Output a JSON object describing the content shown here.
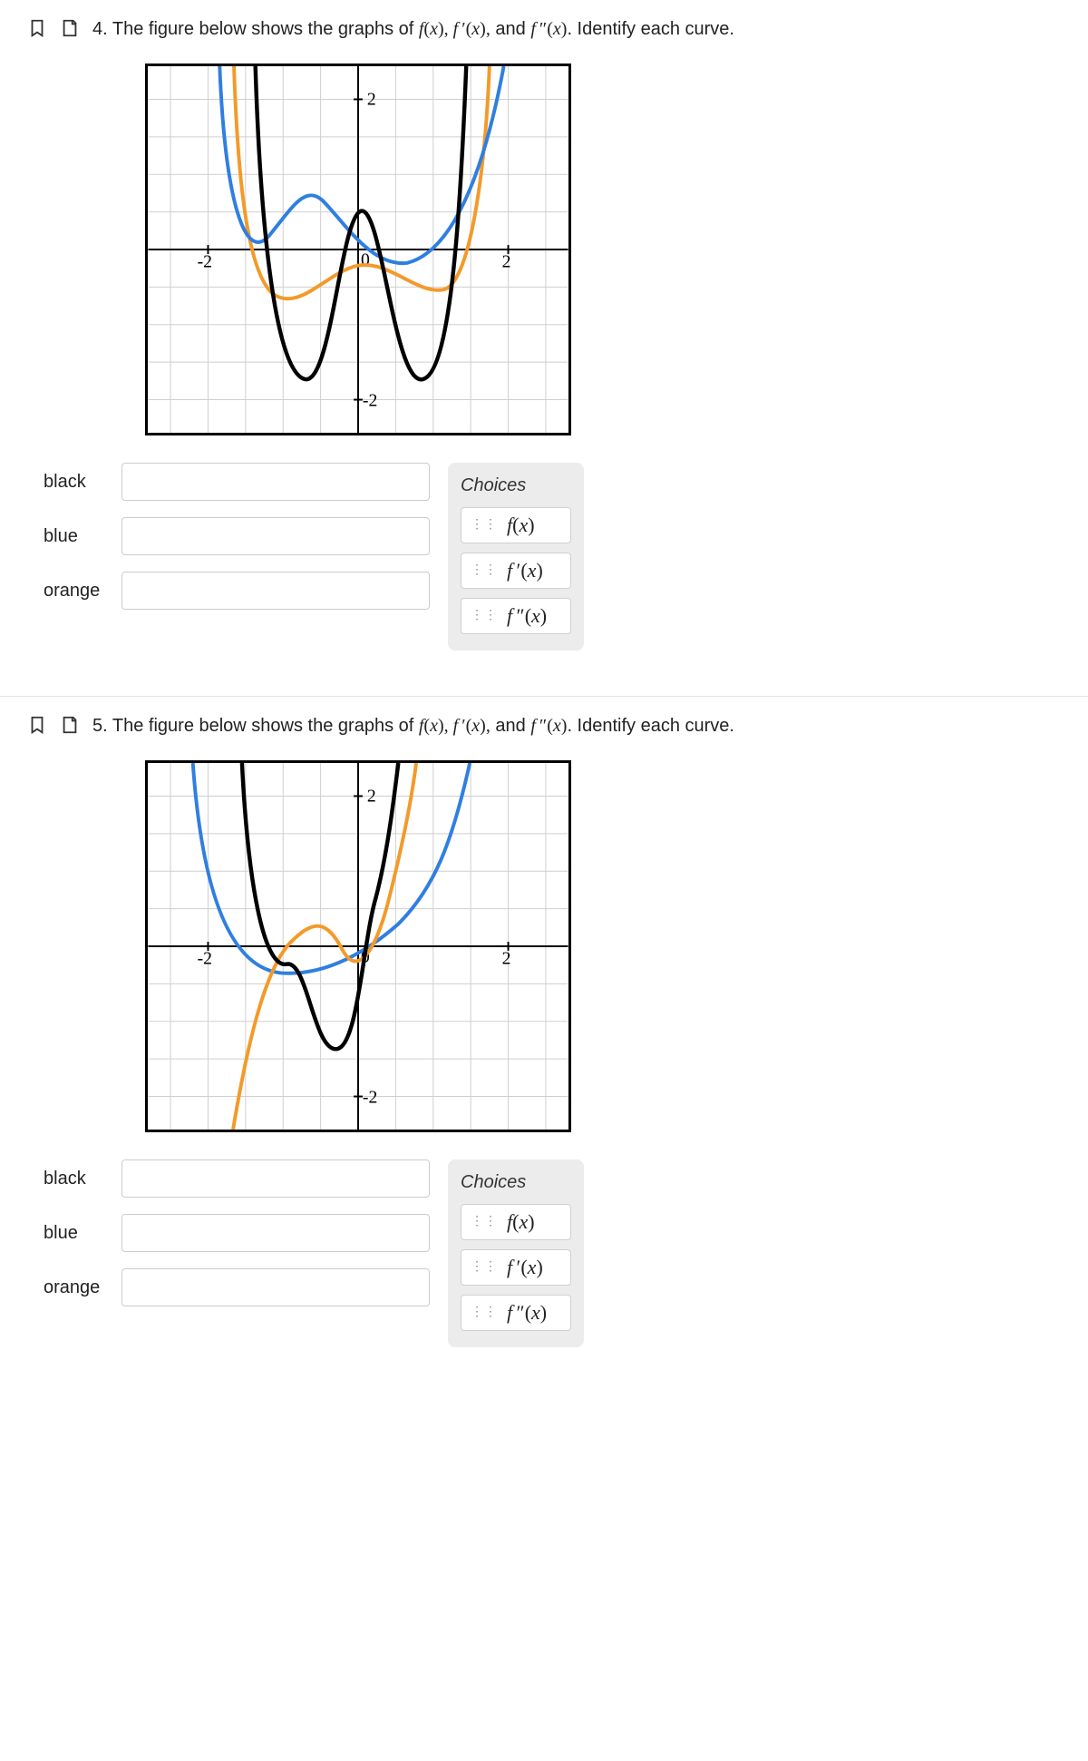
{
  "questions": [
    {
      "number": "4.",
      "prompt_prefix": "The figure below shows the graphs of ",
      "prompt_math": "f(x), f′(x), and f″(x).",
      "prompt_suffix": " Identify each curve.",
      "slots": [
        "black",
        "blue",
        "orange"
      ],
      "choices_title": "Choices",
      "choices": [
        "f(x)",
        "f′(x)",
        "f″(x)"
      ],
      "chart_data": {
        "type": "line",
        "xlim": [
          -2.8,
          2.8
        ],
        "ylim": [
          -2.6,
          2.6
        ],
        "xticks": [
          -2,
          0,
          2
        ],
        "yticks": [
          -2,
          2
        ],
        "series": [
          {
            "name": "blue",
            "color": "#2f7fe0"
          },
          {
            "name": "orange",
            "color": "#f39a2a"
          },
          {
            "name": "black",
            "color": "#000000"
          }
        ]
      }
    },
    {
      "number": "5.",
      "prompt_prefix": "The figure below shows the graphs of ",
      "prompt_math": "f(x), f′(x), and f″(x).",
      "prompt_suffix": " Identify each curve.",
      "slots": [
        "black",
        "blue",
        "orange"
      ],
      "choices_title": "Choices",
      "choices": [
        "f(x)",
        "f′(x)",
        "f″(x)"
      ],
      "chart_data": {
        "type": "line",
        "xlim": [
          -2.8,
          2.8
        ],
        "ylim": [
          -2.6,
          2.6
        ],
        "xticks": [
          -2,
          0,
          2
        ],
        "yticks": [
          -2,
          2
        ],
        "series": [
          {
            "name": "blue",
            "color": "#2f7fe0"
          },
          {
            "name": "orange",
            "color": "#f39a2a"
          },
          {
            "name": "black",
            "color": "#000000"
          }
        ]
      }
    }
  ]
}
